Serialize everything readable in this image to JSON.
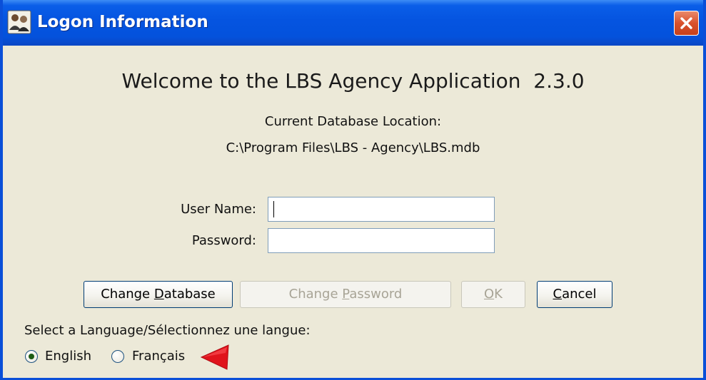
{
  "window": {
    "title": "Logon Information",
    "app_icon": "people-icon",
    "close_icon": "close-icon"
  },
  "header": {
    "welcome": "Welcome to the LBS Agency Application  2.3.0",
    "db_location_label": "Current Database Location:",
    "db_location_path": "C:\\Program Files\\LBS - Agency\\LBS.mdb"
  },
  "form": {
    "username_label": "User Name:",
    "username_value": "",
    "password_label": "Password:",
    "password_value": ""
  },
  "buttons": {
    "change_database": {
      "before": "Change ",
      "hotkey": "D",
      "after": "atabase",
      "enabled": true
    },
    "change_password": {
      "before": "Change ",
      "hotkey": "P",
      "after": "assword",
      "enabled": false
    },
    "ok": {
      "before": "",
      "hotkey": "O",
      "after": "K",
      "enabled": false
    },
    "cancel": {
      "before": "",
      "hotkey": "C",
      "after": "ancel",
      "enabled": true
    }
  },
  "language": {
    "prompt": "Select a Language/Sélectionnez une langue:",
    "options": [
      {
        "label": "English",
        "selected": true
      },
      {
        "label": "Français",
        "selected": false
      }
    ],
    "annotation_icon": "red-arrow-icon"
  },
  "colors": {
    "title_bar": "#0554e0",
    "dialog_bg": "#ece9d8",
    "close_button": "#d9512c",
    "arrow": "#e0141c"
  }
}
